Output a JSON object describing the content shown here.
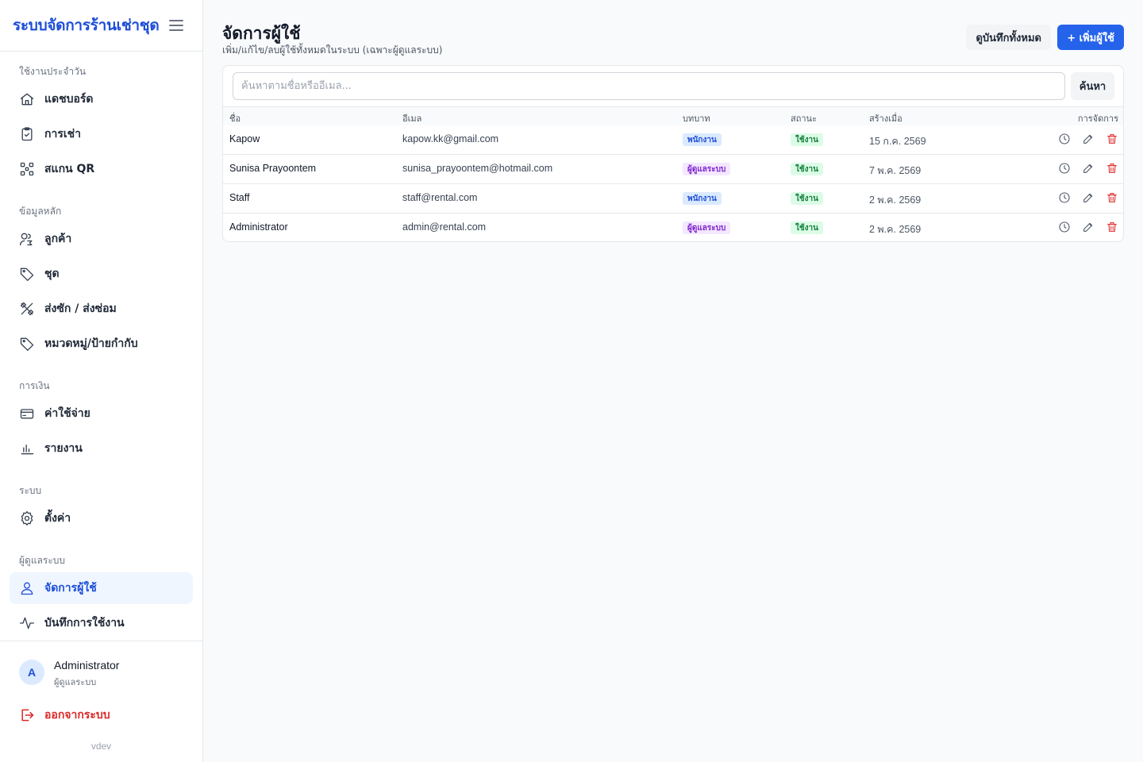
{
  "app": {
    "brand": "ระบบจัดการร้านเช่าชุด",
    "version": "vdev"
  },
  "sidebar": {
    "sections": [
      {
        "label": "ใช้งานประจำวัน"
      },
      {
        "label": "ข้อมูลหลัก"
      },
      {
        "label": "การเงิน"
      },
      {
        "label": "ระบบ"
      },
      {
        "label": "ผู้ดูแลระบบ"
      }
    ],
    "items": [
      {
        "label": "แดชบอร์ด",
        "icon": "home-icon"
      },
      {
        "label": "การเช่า",
        "icon": "clipboard-icon"
      },
      {
        "label": "สแกน QR",
        "icon": "qr-icon"
      },
      {
        "label": "ลูกค้า",
        "icon": "users-icon"
      },
      {
        "label": "ชุด",
        "icon": "tag-icon"
      },
      {
        "label": "ส่งซัก / ส่งซ่อม",
        "icon": "tools-icon"
      },
      {
        "label": "หมวดหมู่/ป้ายกำกับ",
        "icon": "tag-icon"
      },
      {
        "label": "ค่าใช้จ่าย",
        "icon": "card-icon"
      },
      {
        "label": "รายงาน",
        "icon": "bar-chart-icon"
      },
      {
        "label": "ตั้งค่า",
        "icon": "gear-icon"
      },
      {
        "label": "จัดการผู้ใช้",
        "icon": "user-icon",
        "active": true
      },
      {
        "label": "บันทึกการใช้งาน",
        "icon": "activity-icon"
      }
    ],
    "user": {
      "initial": "A",
      "name": "Administrator",
      "role": "ผู้ดูแลระบบ"
    },
    "logout_label": "ออกจากระบบ"
  },
  "header": {
    "title": "จัดการผู้ใช้",
    "subtitle": "เพิ่ม/แก้ไข/ลบผู้ใช้ทั้งหมดในระบบ (เฉพาะผู้ดูแลระบบ)",
    "logs_button": "ดูบันทึกทั้งหมด",
    "add_button": "+ เพิ่มผู้ใช้"
  },
  "search": {
    "placeholder": "ค้นหาตามชื่อหรืออีเมล...",
    "value": "",
    "button": "ค้นหา"
  },
  "table": {
    "columns": [
      "ชื่อ",
      "อีเมล",
      "บทบาท",
      "สถานะ",
      "สร้างเมื่อ",
      "การจัดการ"
    ],
    "rows": [
      {
        "name": "Kapow",
        "email": "kapow.kk@gmail.com",
        "role": "พนักงาน",
        "role_type": "staff",
        "status": "ใช้งาน",
        "created": "15 ก.ค. 2569"
      },
      {
        "name": "Sunisa Prayoontem",
        "email": "sunisa_prayoontem@hotmail.com",
        "role": "ผู้ดูแลระบบ",
        "role_type": "admin",
        "status": "ใช้งาน",
        "created": "7 พ.ค. 2569"
      },
      {
        "name": "Staff",
        "email": "staff@rental.com",
        "role": "พนักงาน",
        "role_type": "staff",
        "status": "ใช้งาน",
        "created": "2 พ.ค. 2569"
      },
      {
        "name": "Administrator",
        "email": "admin@rental.com",
        "role": "ผู้ดูแลระบบ",
        "role_type": "admin",
        "status": "ใช้งาน",
        "created": "2 พ.ค. 2569"
      }
    ]
  },
  "colors": {
    "accent": "#2563eb",
    "staff_badge_bg": "#dbeafe",
    "staff_badge_fg": "#1d4ed8",
    "admin_badge_bg": "#f3e8ff",
    "admin_badge_fg": "#7e22ce",
    "status_bg": "#dcfce7",
    "status_fg": "#15803d",
    "danger": "#dc2626"
  }
}
